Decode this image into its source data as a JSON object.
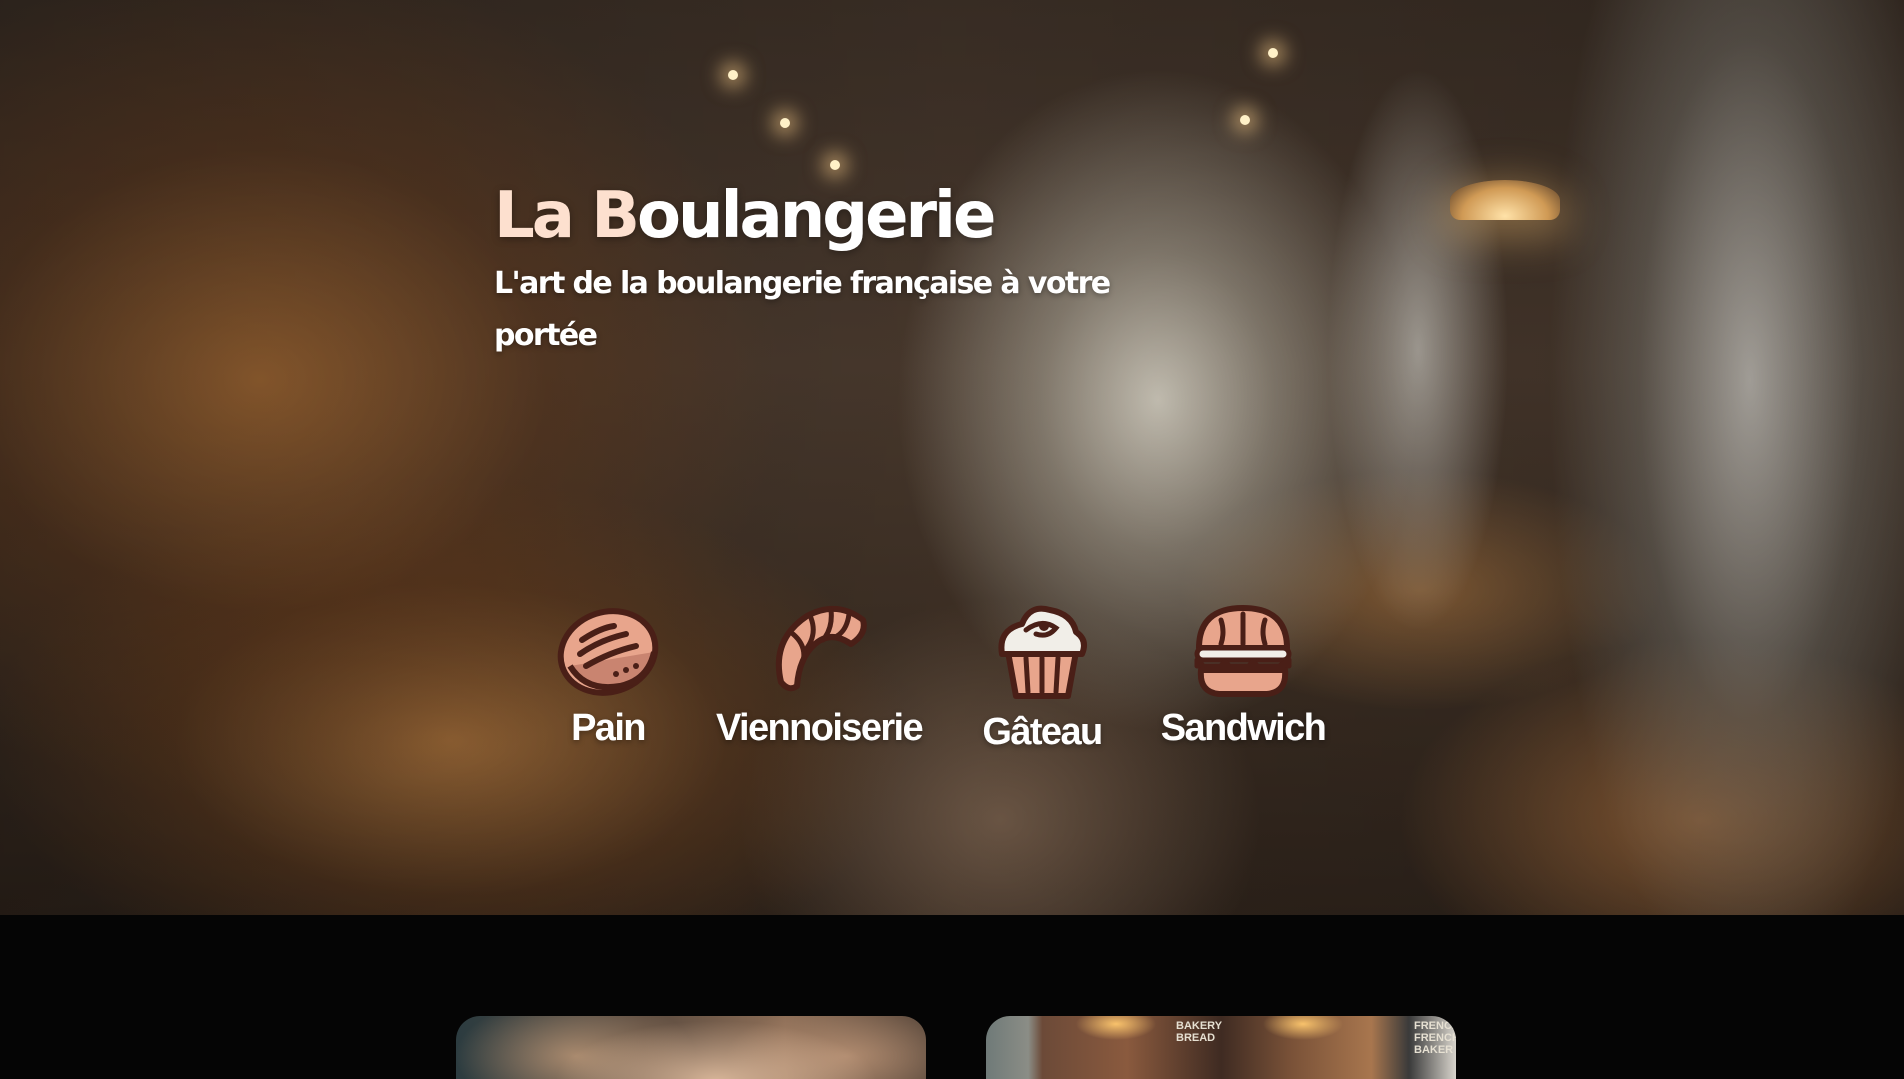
{
  "hero": {
    "title_accent_1": "La ",
    "title_accent_2": "B",
    "title_rest": "oulangerie",
    "subtitle": "L'art de la boulangerie française à votre portée"
  },
  "categories": [
    {
      "label": "Pain",
      "icon": "bread-loaf-icon"
    },
    {
      "label": "Viennoiserie",
      "icon": "croissant-icon"
    },
    {
      "label": "Gâteau",
      "icon": "cupcake-icon"
    },
    {
      "label": "Sandwich",
      "icon": "sandwich-icon"
    }
  ],
  "cards": {
    "right_sign_1": "BAKERY BREAD",
    "right_sign_2": "FRENCH FRENCH BAKER"
  },
  "colors": {
    "title_accent": "#fde0cf",
    "text": "#ffffff",
    "page_background": "#050505",
    "icon_outline": "#4a1f17",
    "icon_fill": "#e8a58c"
  }
}
